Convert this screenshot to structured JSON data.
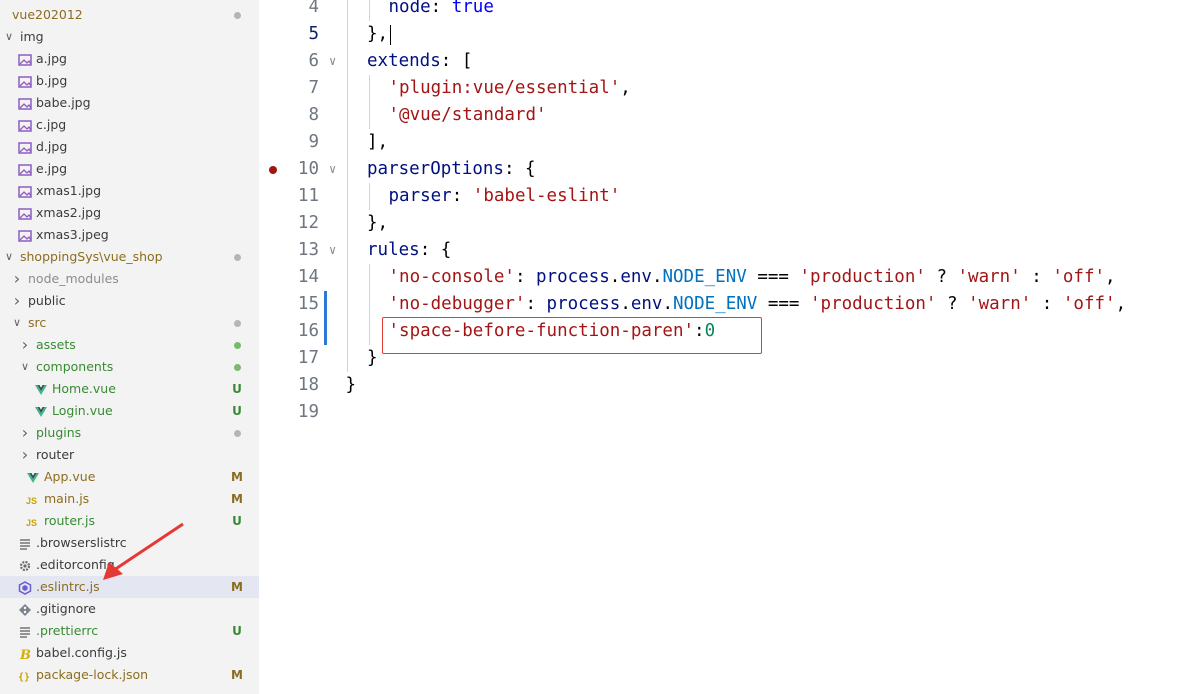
{
  "explorer": {
    "items": [
      {
        "label": "vue202012",
        "indent": 0,
        "chevron": "",
        "icon": "",
        "labelColor": "#8c6d1f",
        "badge": "",
        "badgeColor": "",
        "dot": "#b5b5b5"
      },
      {
        "label": "img",
        "indent": 0,
        "chevron": "expanded",
        "icon": "",
        "labelColor": "#3b3b3b",
        "badge": "",
        "badgeColor": "",
        "dot": ""
      },
      {
        "label": "a.jpg",
        "indent": 1,
        "chevron": "",
        "icon": "image",
        "labelColor": "#3b3b3b",
        "badge": "",
        "badgeColor": "",
        "dot": ""
      },
      {
        "label": "b.jpg",
        "indent": 1,
        "chevron": "",
        "icon": "image",
        "labelColor": "#3b3b3b",
        "badge": "",
        "badgeColor": "",
        "dot": ""
      },
      {
        "label": "babe.jpg",
        "indent": 1,
        "chevron": "",
        "icon": "image",
        "labelColor": "#3b3b3b",
        "badge": "",
        "badgeColor": "",
        "dot": ""
      },
      {
        "label": "c.jpg",
        "indent": 1,
        "chevron": "",
        "icon": "image",
        "labelColor": "#3b3b3b",
        "badge": "",
        "badgeColor": "",
        "dot": ""
      },
      {
        "label": "d.jpg",
        "indent": 1,
        "chevron": "",
        "icon": "image",
        "labelColor": "#3b3b3b",
        "badge": "",
        "badgeColor": "",
        "dot": ""
      },
      {
        "label": "e.jpg",
        "indent": 1,
        "chevron": "",
        "icon": "image",
        "labelColor": "#3b3b3b",
        "badge": "",
        "badgeColor": "",
        "dot": ""
      },
      {
        "label": "xmas1.jpg",
        "indent": 1,
        "chevron": "",
        "icon": "image",
        "labelColor": "#3b3b3b",
        "badge": "",
        "badgeColor": "",
        "dot": ""
      },
      {
        "label": "xmas2.jpg",
        "indent": 1,
        "chevron": "",
        "icon": "image",
        "labelColor": "#3b3b3b",
        "badge": "",
        "badgeColor": "",
        "dot": ""
      },
      {
        "label": "xmas3.jpeg",
        "indent": 1,
        "chevron": "",
        "icon": "image",
        "labelColor": "#3b3b3b",
        "badge": "",
        "badgeColor": "",
        "dot": ""
      },
      {
        "label": "shoppingSys\\vue_shop",
        "indent": 0,
        "chevron": "expanded",
        "icon": "",
        "labelColor": "#8c6d1f",
        "badge": "",
        "badgeColor": "",
        "dot": "#b5b5b5"
      },
      {
        "label": "node_modules",
        "indent": 1,
        "chevron": "collapsed",
        "icon": "",
        "labelColor": "#8c8c8c",
        "badge": "",
        "badgeColor": "",
        "dot": ""
      },
      {
        "label": "public",
        "indent": 1,
        "chevron": "collapsed",
        "icon": "",
        "labelColor": "#3b3b3b",
        "badge": "",
        "badgeColor": "",
        "dot": ""
      },
      {
        "label": "src",
        "indent": 1,
        "chevron": "expanded",
        "icon": "",
        "labelColor": "#8c6d1f",
        "badge": "",
        "badgeColor": "",
        "dot": "#b5b5b5"
      },
      {
        "label": "assets",
        "indent": 2,
        "chevron": "collapsed",
        "icon": "",
        "labelColor": "#388a34",
        "badge": "",
        "badgeColor": "",
        "dot": "#79b96b"
      },
      {
        "label": "components",
        "indent": 2,
        "chevron": "expanded",
        "icon": "",
        "labelColor": "#388a34",
        "badge": "",
        "badgeColor": "",
        "dot": "#79b96b"
      },
      {
        "label": "Home.vue",
        "indent": 3,
        "chevron": "",
        "icon": "vue",
        "labelColor": "#388a34",
        "badge": "U",
        "badgeColor": "#388a34",
        "dot": ""
      },
      {
        "label": "Login.vue",
        "indent": 3,
        "chevron": "",
        "icon": "vue",
        "labelColor": "#388a34",
        "badge": "U",
        "badgeColor": "#388a34",
        "dot": ""
      },
      {
        "label": "plugins",
        "indent": 2,
        "chevron": "collapsed",
        "icon": "",
        "labelColor": "#388a34",
        "badge": "",
        "badgeColor": "",
        "dot": "#b5b5b5"
      },
      {
        "label": "router",
        "indent": 2,
        "chevron": "collapsed",
        "icon": "",
        "labelColor": "#3b3b3b",
        "badge": "",
        "badgeColor": "",
        "dot": ""
      },
      {
        "label": "App.vue",
        "indent": 2,
        "chevron": "",
        "icon": "vue",
        "labelColor": "#8c6d1f",
        "badge": "M",
        "badgeColor": "#8c6d1f",
        "dot": ""
      },
      {
        "label": "main.js",
        "indent": 2,
        "chevron": "",
        "icon": "js",
        "labelColor": "#8c6d1f",
        "badge": "M",
        "badgeColor": "#8c6d1f",
        "dot": ""
      },
      {
        "label": "router.js",
        "indent": 2,
        "chevron": "",
        "icon": "js",
        "labelColor": "#388a34",
        "badge": "U",
        "badgeColor": "#388a34",
        "dot": ""
      },
      {
        "label": ".browserslistrc",
        "indent": 1,
        "chevron": "",
        "icon": "lines",
        "labelColor": "#3b3b3b",
        "badge": "",
        "badgeColor": "",
        "dot": ""
      },
      {
        "label": ".editorconfig",
        "indent": 1,
        "chevron": "",
        "icon": "gear",
        "labelColor": "#3b3b3b",
        "badge": "",
        "badgeColor": "",
        "dot": ""
      },
      {
        "label": ".eslintrc.js",
        "indent": 1,
        "chevron": "",
        "icon": "eslint",
        "labelColor": "#8c6d1f",
        "badge": "M",
        "badgeColor": "#8c6d1f",
        "dot": "",
        "selected": true
      },
      {
        "label": ".gitignore",
        "indent": 1,
        "chevron": "",
        "icon": "git",
        "labelColor": "#3b3b3b",
        "badge": "",
        "badgeColor": "",
        "dot": ""
      },
      {
        "label": ".prettierrc",
        "indent": 1,
        "chevron": "",
        "icon": "lines",
        "labelColor": "#388a34",
        "badge": "U",
        "badgeColor": "#388a34",
        "dot": ""
      },
      {
        "label": "babel.config.js",
        "indent": 1,
        "chevron": "",
        "icon": "babel",
        "labelColor": "#3b3b3b",
        "badge": "",
        "badgeColor": "",
        "dot": ""
      },
      {
        "label": "package-lock.json",
        "indent": 1,
        "chevron": "",
        "icon": "json",
        "labelColor": "#8c6d1f",
        "badge": "M",
        "badgeColor": "#8c6d1f",
        "dot": ""
      }
    ]
  },
  "editor": {
    "lines": [
      {
        "num": "4",
        "indent": 1,
        "fold": "",
        "tokens": [
          [
            "p",
            "node"
          ],
          [
            "t",
            ": "
          ],
          [
            "k",
            "true"
          ]
        ]
      },
      {
        "num": "5",
        "indent": 0,
        "fold": "",
        "active": true,
        "modified": false,
        "tokens": [
          [
            "t",
            "},"
          ]
        ]
      },
      {
        "num": "6",
        "indent": 0,
        "fold": "v",
        "tokens": [
          [
            "p",
            "extends"
          ],
          [
            "t",
            ": ["
          ]
        ]
      },
      {
        "num": "7",
        "indent": 1,
        "fold": "",
        "tokens": [
          [
            "s",
            "'plugin:vue/essential'"
          ],
          [
            "t",
            ","
          ]
        ]
      },
      {
        "num": "8",
        "indent": 1,
        "fold": "",
        "tokens": [
          [
            "s",
            "'@vue/standard'"
          ]
        ]
      },
      {
        "num": "9",
        "indent": 0,
        "fold": "",
        "tokens": [
          [
            "t",
            "],"
          ]
        ]
      },
      {
        "num": "10",
        "indent": 0,
        "fold": "v",
        "breakpoint": true,
        "tokens": [
          [
            "p",
            "parserOptions"
          ],
          [
            "t",
            ": {"
          ]
        ]
      },
      {
        "num": "11",
        "indent": 1,
        "fold": "",
        "tokens": [
          [
            "p",
            "parser"
          ],
          [
            "t",
            ": "
          ],
          [
            "s",
            "'babel-eslint'"
          ]
        ]
      },
      {
        "num": "12",
        "indent": 0,
        "fold": "",
        "tokens": [
          [
            "t",
            "},"
          ]
        ]
      },
      {
        "num": "13",
        "indent": 0,
        "fold": "v",
        "tokens": [
          [
            "p",
            "rules"
          ],
          [
            "t",
            ": {"
          ]
        ]
      },
      {
        "num": "14",
        "indent": 1,
        "fold": "",
        "tokens": [
          [
            "s",
            "'no-console'"
          ],
          [
            "t",
            ": "
          ],
          [
            "p",
            "process"
          ],
          [
            "t",
            "."
          ],
          [
            "p",
            "env"
          ],
          [
            "t",
            "."
          ],
          [
            "c",
            "NODE_ENV"
          ],
          [
            "t",
            " === "
          ],
          [
            "s",
            "'production'"
          ],
          [
            "t",
            " ? "
          ],
          [
            "s",
            "'warn'"
          ],
          [
            "t",
            " : "
          ],
          [
            "s",
            "'off'"
          ],
          [
            "t",
            ","
          ]
        ]
      },
      {
        "num": "15",
        "indent": 1,
        "fold": "",
        "modified": true,
        "tokens": [
          [
            "s",
            "'no-debugger'"
          ],
          [
            "t",
            ": "
          ],
          [
            "p",
            "process"
          ],
          [
            "t",
            "."
          ],
          [
            "p",
            "env"
          ],
          [
            "t",
            "."
          ],
          [
            "c",
            "NODE_ENV"
          ],
          [
            "t",
            " === "
          ],
          [
            "s",
            "'production'"
          ],
          [
            "t",
            " ? "
          ],
          [
            "s",
            "'warn'"
          ],
          [
            "t",
            " : "
          ],
          [
            "s",
            "'off'"
          ],
          [
            "t",
            ","
          ]
        ]
      },
      {
        "num": "16",
        "indent": 1,
        "fold": "",
        "modified": true,
        "tokens": [
          [
            "s",
            "'space-before-function-paren'"
          ],
          [
            "t",
            ":"
          ],
          [
            "n",
            "0"
          ]
        ]
      },
      {
        "num": "17",
        "indent": 0,
        "fold": "",
        "tokens": [
          [
            "t",
            "}"
          ]
        ]
      },
      {
        "num": "18",
        "indent": -1,
        "fold": "",
        "tokens": [
          [
            "t",
            "}"
          ]
        ]
      },
      {
        "num": "19",
        "indent": -1,
        "fold": "",
        "tokens": []
      }
    ]
  }
}
